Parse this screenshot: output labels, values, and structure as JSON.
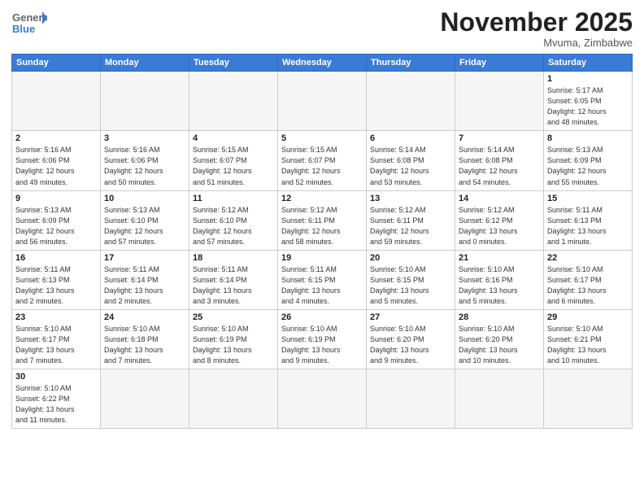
{
  "header": {
    "logo_general": "General",
    "logo_blue": "Blue",
    "month_title": "November 2025",
    "location": "Mvuma, Zimbabwe"
  },
  "days_of_week": [
    "Sunday",
    "Monday",
    "Tuesday",
    "Wednesday",
    "Thursday",
    "Friday",
    "Saturday"
  ],
  "weeks": [
    [
      {
        "day": "",
        "info": ""
      },
      {
        "day": "",
        "info": ""
      },
      {
        "day": "",
        "info": ""
      },
      {
        "day": "",
        "info": ""
      },
      {
        "day": "",
        "info": ""
      },
      {
        "day": "",
        "info": ""
      },
      {
        "day": "1",
        "info": "Sunrise: 5:17 AM\nSunset: 6:05 PM\nDaylight: 12 hours\nand 48 minutes."
      }
    ],
    [
      {
        "day": "2",
        "info": "Sunrise: 5:16 AM\nSunset: 6:06 PM\nDaylight: 12 hours\nand 49 minutes."
      },
      {
        "day": "3",
        "info": "Sunrise: 5:16 AM\nSunset: 6:06 PM\nDaylight: 12 hours\nand 50 minutes."
      },
      {
        "day": "4",
        "info": "Sunrise: 5:15 AM\nSunset: 6:07 PM\nDaylight: 12 hours\nand 51 minutes."
      },
      {
        "day": "5",
        "info": "Sunrise: 5:15 AM\nSunset: 6:07 PM\nDaylight: 12 hours\nand 52 minutes."
      },
      {
        "day": "6",
        "info": "Sunrise: 5:14 AM\nSunset: 6:08 PM\nDaylight: 12 hours\nand 53 minutes."
      },
      {
        "day": "7",
        "info": "Sunrise: 5:14 AM\nSunset: 6:08 PM\nDaylight: 12 hours\nand 54 minutes."
      },
      {
        "day": "8",
        "info": "Sunrise: 5:13 AM\nSunset: 6:09 PM\nDaylight: 12 hours\nand 55 minutes."
      }
    ],
    [
      {
        "day": "9",
        "info": "Sunrise: 5:13 AM\nSunset: 6:09 PM\nDaylight: 12 hours\nand 56 minutes."
      },
      {
        "day": "10",
        "info": "Sunrise: 5:13 AM\nSunset: 6:10 PM\nDaylight: 12 hours\nand 57 minutes."
      },
      {
        "day": "11",
        "info": "Sunrise: 5:12 AM\nSunset: 6:10 PM\nDaylight: 12 hours\nand 57 minutes."
      },
      {
        "day": "12",
        "info": "Sunrise: 5:12 AM\nSunset: 6:11 PM\nDaylight: 12 hours\nand 58 minutes."
      },
      {
        "day": "13",
        "info": "Sunrise: 5:12 AM\nSunset: 6:11 PM\nDaylight: 12 hours\nand 59 minutes."
      },
      {
        "day": "14",
        "info": "Sunrise: 5:12 AM\nSunset: 6:12 PM\nDaylight: 13 hours\nand 0 minutes."
      },
      {
        "day": "15",
        "info": "Sunrise: 5:11 AM\nSunset: 6:13 PM\nDaylight: 13 hours\nand 1 minute."
      }
    ],
    [
      {
        "day": "16",
        "info": "Sunrise: 5:11 AM\nSunset: 6:13 PM\nDaylight: 13 hours\nand 2 minutes."
      },
      {
        "day": "17",
        "info": "Sunrise: 5:11 AM\nSunset: 6:14 PM\nDaylight: 13 hours\nand 2 minutes."
      },
      {
        "day": "18",
        "info": "Sunrise: 5:11 AM\nSunset: 6:14 PM\nDaylight: 13 hours\nand 3 minutes."
      },
      {
        "day": "19",
        "info": "Sunrise: 5:11 AM\nSunset: 6:15 PM\nDaylight: 13 hours\nand 4 minutes."
      },
      {
        "day": "20",
        "info": "Sunrise: 5:10 AM\nSunset: 6:15 PM\nDaylight: 13 hours\nand 5 minutes."
      },
      {
        "day": "21",
        "info": "Sunrise: 5:10 AM\nSunset: 6:16 PM\nDaylight: 13 hours\nand 5 minutes."
      },
      {
        "day": "22",
        "info": "Sunrise: 5:10 AM\nSunset: 6:17 PM\nDaylight: 13 hours\nand 6 minutes."
      }
    ],
    [
      {
        "day": "23",
        "info": "Sunrise: 5:10 AM\nSunset: 6:17 PM\nDaylight: 13 hours\nand 7 minutes."
      },
      {
        "day": "24",
        "info": "Sunrise: 5:10 AM\nSunset: 6:18 PM\nDaylight: 13 hours\nand 7 minutes."
      },
      {
        "day": "25",
        "info": "Sunrise: 5:10 AM\nSunset: 6:19 PM\nDaylight: 13 hours\nand 8 minutes."
      },
      {
        "day": "26",
        "info": "Sunrise: 5:10 AM\nSunset: 6:19 PM\nDaylight: 13 hours\nand 9 minutes."
      },
      {
        "day": "27",
        "info": "Sunrise: 5:10 AM\nSunset: 6:20 PM\nDaylight: 13 hours\nand 9 minutes."
      },
      {
        "day": "28",
        "info": "Sunrise: 5:10 AM\nSunset: 6:20 PM\nDaylight: 13 hours\nand 10 minutes."
      },
      {
        "day": "29",
        "info": "Sunrise: 5:10 AM\nSunset: 6:21 PM\nDaylight: 13 hours\nand 10 minutes."
      }
    ],
    [
      {
        "day": "30",
        "info": "Sunrise: 5:10 AM\nSunset: 6:22 PM\nDaylight: 13 hours\nand 11 minutes."
      },
      {
        "day": "",
        "info": ""
      },
      {
        "day": "",
        "info": ""
      },
      {
        "day": "",
        "info": ""
      },
      {
        "day": "",
        "info": ""
      },
      {
        "day": "",
        "info": ""
      },
      {
        "day": "",
        "info": ""
      }
    ]
  ]
}
